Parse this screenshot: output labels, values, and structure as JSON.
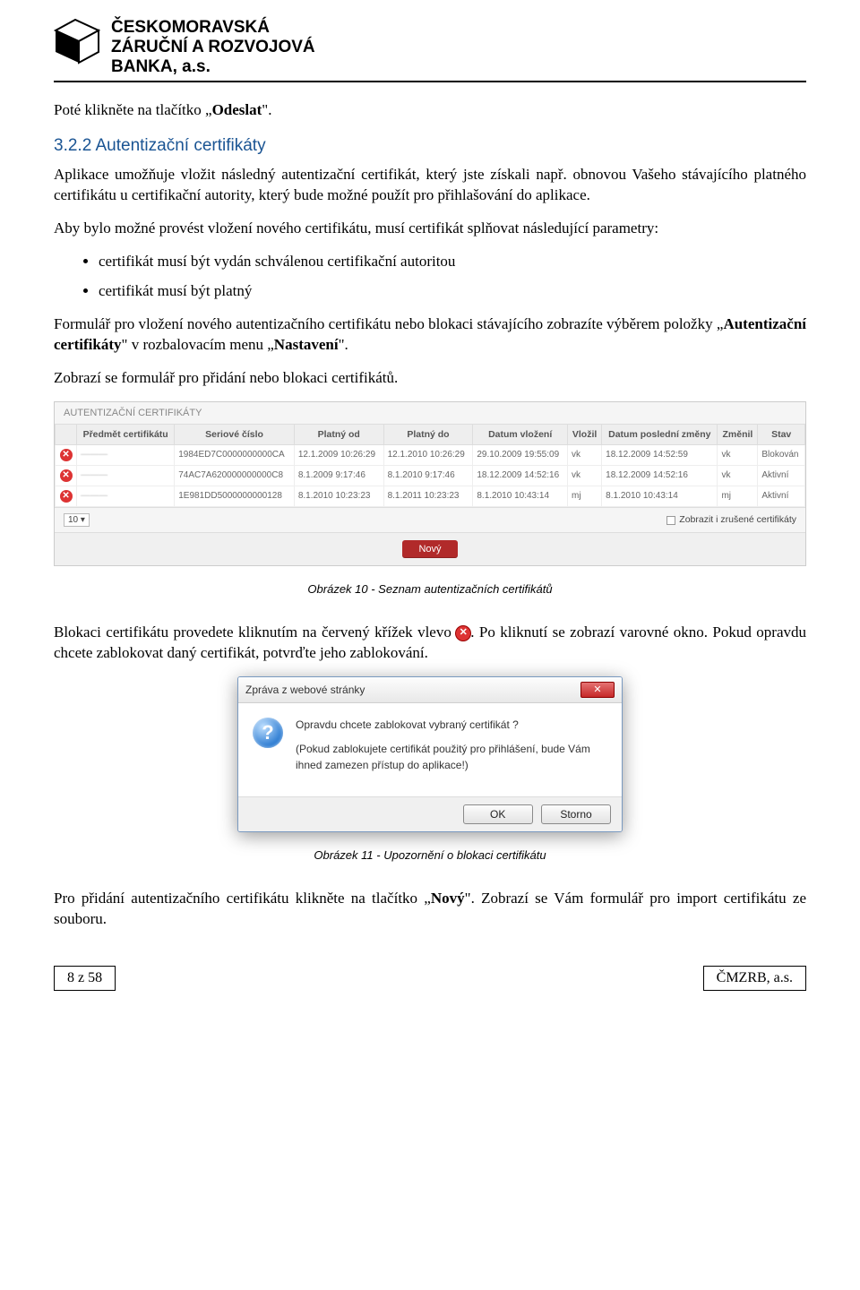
{
  "company": {
    "line1": "ČESKOMORAVSKÁ",
    "line2": "ZÁRUČNÍ A ROZVOJOVÁ",
    "line3": "BANKA, a.s."
  },
  "intro": {
    "click_send_prefix": "Poté klikněte na tlačítko „",
    "click_send_bold": "Odeslat",
    "click_send_suffix": "\"."
  },
  "section": {
    "num": "3.2.2",
    "title": "Autentizační certifikáty"
  },
  "p1": "Aplikace umožňuje vložit následný autentizační certifikát, který jste získali např. obnovou Vašeho stávajícího platného certifikátu u certifikační autority, který bude možné použít pro přihlašování do aplikace.",
  "p2": "Aby bylo možné provést vložení nového certifikátu, musí certifikát splňovat následující parametry:",
  "bullets": [
    "certifikát musí být vydán schválenou certifikační autoritou",
    "certifikát musí být platný"
  ],
  "p3_a": "Formulář pro vložení nového autentizačního certifikátu nebo blokaci stávajícího zobrazíte výběrem položky „",
  "p3_b": "Autentizační certifikáty",
  "p3_c": "\" v rozbalovacím menu „",
  "p3_d": "Nastavení",
  "p3_e": "\".",
  "p4": "Zobrazí se formulář pro přidání nebo blokaci certifikátů.",
  "cert_panel": {
    "title": "AUTENTIZAČNÍ CERTIFIKÁTY",
    "headers": [
      "",
      "Předmět certifikátu",
      "Seriové číslo",
      "Platný od",
      "Platný do",
      "Datum vložení",
      "Vložil",
      "Datum poslední změny",
      "Změnil",
      "Stav"
    ],
    "rows": [
      {
        "subject": "———",
        "serial": "1984ED7C0000000000CA",
        "from": "12.1.2009 10:26:29",
        "to": "12.1.2010 10:26:29",
        "ins": "29.10.2009 19:55:09",
        "by": "vk",
        "chg": "18.12.2009 14:52:59",
        "chgby": "vk",
        "status": "Blokován"
      },
      {
        "subject": "———",
        "serial": "74AC7A620000000000C8",
        "from": "8.1.2009 9:17:46",
        "to": "8.1.2010 9:17:46",
        "ins": "18.12.2009 14:52:16",
        "by": "vk",
        "chg": "18.12.2009 14:52:16",
        "chgby": "vk",
        "status": "Aktivní"
      },
      {
        "subject": "———",
        "serial": "1E981DD5000000000128",
        "from": "8.1.2010 10:23:23",
        "to": "8.1.2011 10:23:23",
        "ins": "8.1.2010 10:43:14",
        "by": "mj",
        "chg": "8.1.2010 10:43:14",
        "chgby": "mj",
        "status": "Aktivní"
      }
    ],
    "pager_value": "10",
    "show_cancelled": "Zobrazit i zrušené certifikáty",
    "new_btn": "Nový"
  },
  "caption1": "Obrázek 10 - Seznam autentizačních certifikátů",
  "p5_a": "Blokaci certifikátu provedete kliknutím na červený křížek vlevo ",
  "p5_b": ". Po kliknutí se zobrazí varovné okno. Pokud opravdu chcete zablokovat daný certifikát, potvrďte jeho zablokování.",
  "dialog": {
    "title": "Zpráva z webové stránky",
    "line1": "Opravdu chcete zablokovat vybraný certifikát ?",
    "line2": "(Pokud zablokujete certifikát použitý pro přihlášení, bude Vám ihned zamezen přístup do aplikace!)",
    "ok": "OK",
    "cancel": "Storno"
  },
  "caption2": "Obrázek 11 - Upozornění o blokaci certifikátu",
  "p6_a": "Pro přidání autentizačního certifikátu klikněte na tlačítko „",
  "p6_b": "Nový",
  "p6_c": "\". Zobrazí se Vám formulář pro import certifikátu ze souboru.",
  "footer": {
    "left": "8 z 58",
    "right": "ČMZRB, a.s."
  }
}
